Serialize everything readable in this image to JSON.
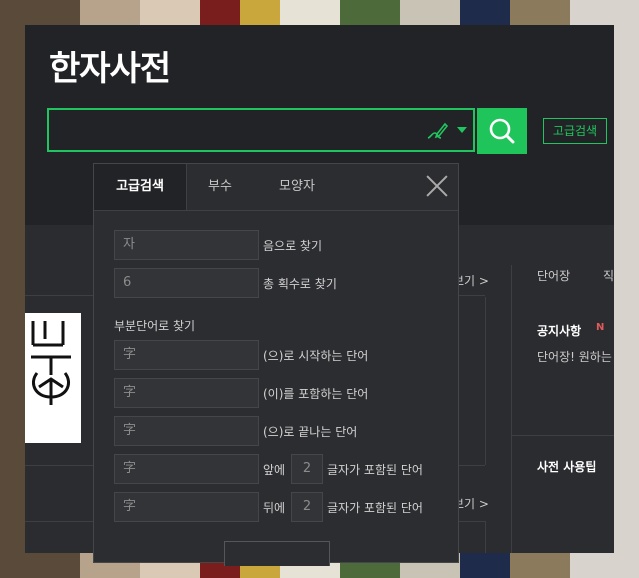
{
  "header": {
    "logo": "한자사전",
    "search_placeholder": "",
    "advanced_button": "고급검색"
  },
  "popup": {
    "tabs": [
      "고급검색",
      "부수",
      "모양자"
    ],
    "reading": {
      "value": "자",
      "label": "음으로 찾기"
    },
    "strokes": {
      "value": "6",
      "label": "총 획수로 찾기"
    },
    "section_title": "부분단어로 찾기",
    "rows": [
      {
        "value": "字",
        "label": "(으)로 시작하는 단어"
      },
      {
        "value": "字",
        "label": "(이)를 포함하는 단어"
      },
      {
        "value": "字",
        "label": "(으)로 끝나는 단어"
      }
    ],
    "before": {
      "value": "字",
      "prefix": "앞에",
      "count": "2",
      "suffix": "글자가 포함된 단어"
    },
    "after": {
      "value": "字",
      "prefix": "뒤에",
      "count": "2",
      "suffix": "글자가 포함된 단어"
    }
  },
  "right": {
    "tab1": "단어장",
    "tab2": "직",
    "notice_title": "공지사항",
    "notice_badge": "N",
    "notice_text": "단어장! 원하는",
    "tips_title": "사전 사용팁"
  },
  "more1": "보기 >",
  "more2": "보기 >",
  "colors": {
    "accent": "#21c55f",
    "bg": "#222326"
  }
}
